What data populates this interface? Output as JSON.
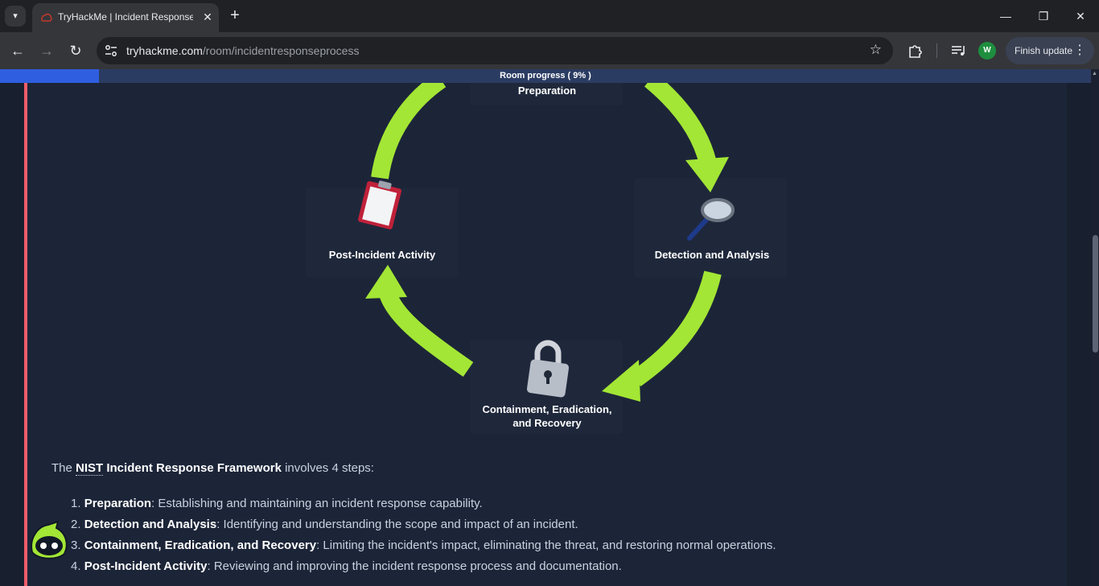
{
  "browser": {
    "tab_title": "TryHackMe | Incident Response Process",
    "url_host": "tryhackme.com",
    "url_path": "/room/incidentresponseprocess",
    "profile_initial": "W",
    "finish_update_label": "Finish update"
  },
  "progress": {
    "label": "Room progress ( 9% )",
    "percent": 9
  },
  "diagram": {
    "stages": {
      "preparation": "Preparation",
      "detection": "Detection and Analysis",
      "containment_line1": "Containment, Eradication,",
      "containment_line2": "and Recovery",
      "post_incident": "Post-Incident Activity"
    },
    "arrow_color": "#a3e635"
  },
  "content": {
    "intro_prefix": "The ",
    "intro_abbr": "NIST",
    "intro_bold": " Incident Response Framework",
    "intro_suffix": " involves 4 steps:",
    "steps": [
      {
        "num": "1. ",
        "title": "Preparation",
        "desc": ": Establishing and maintaining an incident response capability."
      },
      {
        "num": "2. ",
        "title": "Detection and Analysis",
        "desc": ": Identifying and understanding the scope and impact of an incident."
      },
      {
        "num": "3. ",
        "title": "Containment, Eradication, and Recovery",
        "desc": ": Limiting the incident's impact, eliminating the threat, and restoring normal operations."
      },
      {
        "num": "4. ",
        "title": "Post-Incident Activity",
        "desc": ": Reviewing and improving the incident response process and documentation."
      }
    ]
  },
  "colors": {
    "accent_border": "#f15c6a",
    "progress_fill": "#2f5fe0",
    "panel_bg": "#1c2538"
  }
}
